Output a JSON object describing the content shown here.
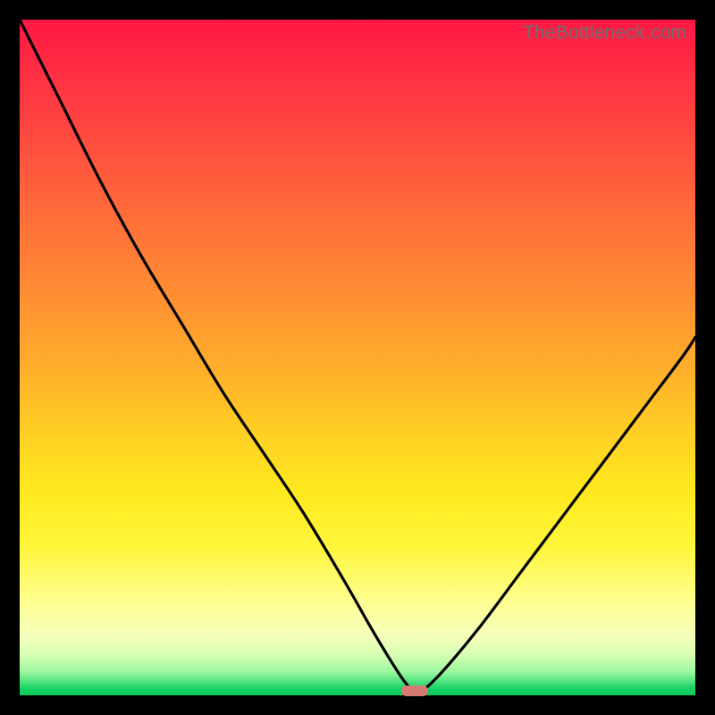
{
  "watermark": "TheBottleneck.com",
  "colors": {
    "frame": "#000000",
    "curve": "#000000",
    "marker": "#d87a74",
    "watermark": "#6e6e6e"
  },
  "chart_data": {
    "type": "line",
    "title": "",
    "xlabel": "",
    "ylabel": "",
    "xlim": [
      0,
      100
    ],
    "ylim": [
      0,
      100
    ],
    "grid": false,
    "legend": false,
    "series": [
      {
        "name": "bottleneck-curve",
        "x": [
          0,
          6,
          12,
          18,
          24,
          30,
          36,
          42,
          48,
          52,
          55,
          57,
          58.5,
          60,
          63,
          68,
          74,
          80,
          86,
          92,
          98,
          100
        ],
        "values": [
          100,
          88,
          76,
          65,
          55,
          45,
          36,
          27,
          17,
          10,
          5,
          2,
          0.5,
          1,
          4,
          10,
          18,
          26,
          34,
          42,
          50,
          53
        ]
      }
    ],
    "marker": {
      "x": 58.5,
      "y": 0.6
    },
    "annotations": []
  }
}
